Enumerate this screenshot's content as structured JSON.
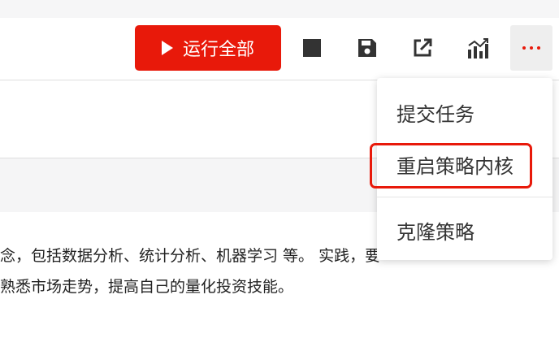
{
  "toolbar": {
    "run_all_label": "运行全部",
    "icons": [
      "stop-icon",
      "save-icon",
      "export-icon",
      "chart-icon",
      "more-icon"
    ]
  },
  "content": {
    "line1": "念，包括数据分析、统计分析、机器学习 等。 实践，要",
    "line2": "熟悉市场走势，提高自己的量化投资技能。"
  },
  "menu": {
    "items": [
      "提交任务",
      "重启策略内核",
      "克隆策略"
    ]
  },
  "colors": {
    "accent": "#e8190a",
    "icon": "#333333"
  }
}
